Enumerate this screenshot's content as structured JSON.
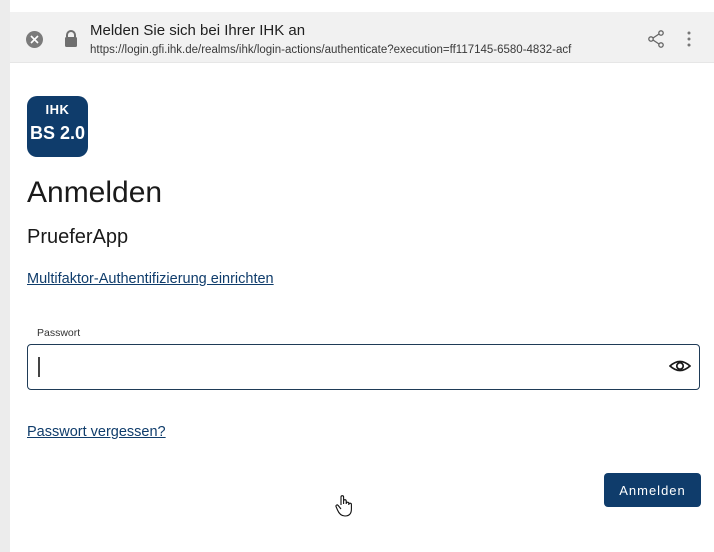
{
  "browser": {
    "tab_title": "Melden Sie sich bei Ihrer IHK an",
    "url": "https://login.gfi.ihk.de/realms/ihk/login-actions/authenticate?execution=ff117145-6580-4832-acf",
    "icons": {
      "close": "close-icon",
      "lock": "lock-icon",
      "share": "share-icon",
      "more": "more-vert-icon"
    }
  },
  "logo": {
    "line1": "IHK",
    "line2": "BS 2.0",
    "color": "#0f3c6b"
  },
  "page": {
    "title": "Anmelden",
    "subtitle": "PrueferApp",
    "mfa_link": "Multifaktor-Authentifizierung einrichten"
  },
  "form": {
    "password_label": "Passwort",
    "password_value": "",
    "forgot_link": "Passwort vergessen?",
    "submit_label": "Anmelden",
    "eye_icon": "eye-icon"
  },
  "colors": {
    "accent": "#0f3c6b",
    "field_border": "#1f3b57"
  }
}
